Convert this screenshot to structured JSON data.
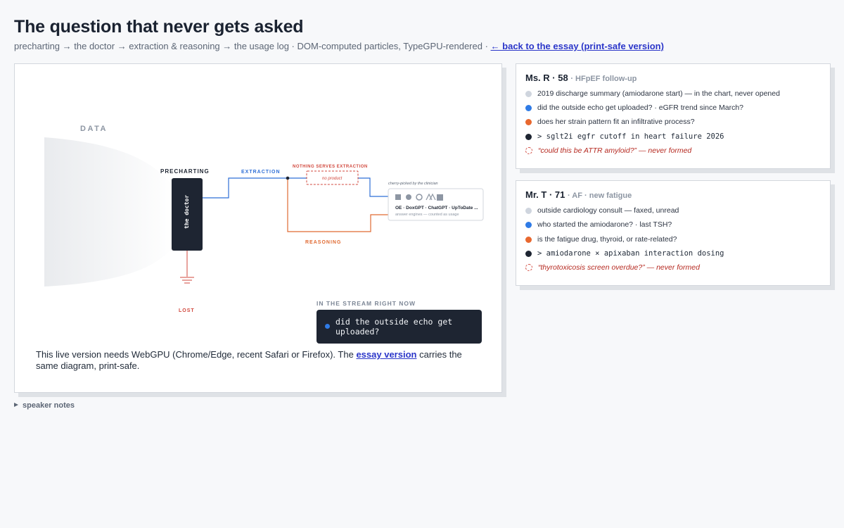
{
  "header": {
    "title": "The question that never gets asked",
    "subtitle": "precharting → the doctor → extraction & reasoning → the usage log · DOM-computed particles, TypeGPU-rendered ·",
    "back_link": "← back to the essay (print-safe version)"
  },
  "diagram": {
    "data_label": "DATA",
    "precharting_label": "PRECHARTING",
    "doctor_label": "the doctor",
    "extraction_label": "EXTRACTION",
    "nothing_serves_label": "NOTHING SERVES EXTRACTION",
    "no_product_label": "no product",
    "reasoning_label": "REASONING",
    "cherry_picked_label": "cherry-picked by the clinician",
    "engines_list": "OE · DoxGPT · ChatGPT · UpToDate ...",
    "engines_caption": "answer engines — counted as usage",
    "lost_label": "LOST",
    "stream_label": "IN THE STREAM RIGHT NOW",
    "stream_text": "did the outside echo get uploaded?",
    "colors": {
      "extraction": "#2f6fd6",
      "reasoning": "#e06a32",
      "lost": "#d1473c",
      "panel": "#1e2532"
    }
  },
  "webgpu_note": {
    "text_before": "This live version needs WebGPU (Chrome/Edge, recent Safari or Firefox). The",
    "link": "essay version",
    "text_after": "carries the same diagram, print-safe."
  },
  "patients": [
    {
      "name": "Ms. R · 58",
      "context": "· HFpEF follow-up",
      "rows": [
        {
          "kind": "grey",
          "text": "2019 discharge summary (amiodarone start) — in the chart, never opened"
        },
        {
          "kind": "blue",
          "text": "did the outside echo get uploaded? · eGFR trend since March?"
        },
        {
          "kind": "orange",
          "text": "does her strain pattern fit an infiltrative process?"
        },
        {
          "kind": "dark",
          "text": "> sglt2i egfr cutoff in heart failure 2026"
        },
        {
          "kind": "dashed",
          "text": "“could this be ATTR amyloid?” — never formed"
        }
      ]
    },
    {
      "name": "Mr. T · 71",
      "context": "· AF · new fatigue",
      "rows": [
        {
          "kind": "grey",
          "text": "outside cardiology consult — faxed, unread"
        },
        {
          "kind": "blue",
          "text": "who started the amiodarone? · last TSH?"
        },
        {
          "kind": "orange",
          "text": "is the fatigue drug, thyroid, or rate-related?"
        },
        {
          "kind": "dark",
          "text": "> amiodarone × apixaban interaction dosing"
        },
        {
          "kind": "dashed",
          "text": "“thyrotoxicosis screen overdue?” — never formed"
        }
      ]
    }
  ],
  "speaker_notes": "speaker notes"
}
